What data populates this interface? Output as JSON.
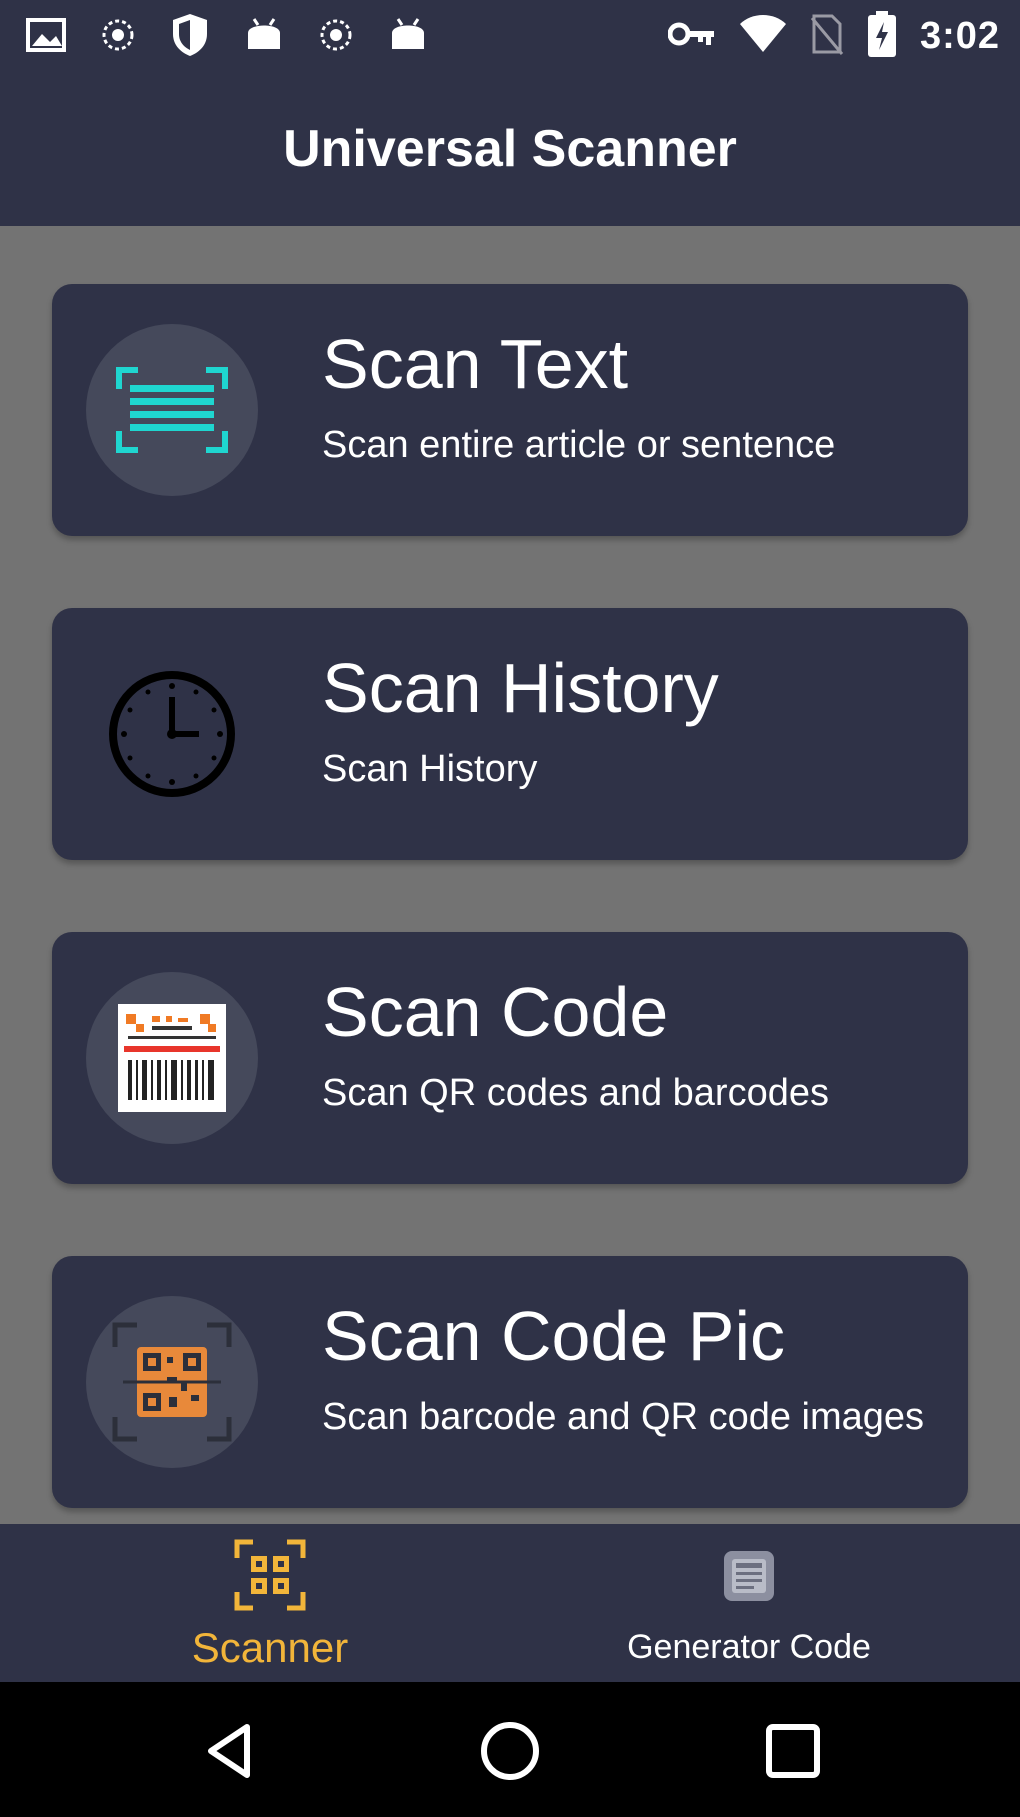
{
  "status_bar": {
    "time": "3:02",
    "left_icons": [
      "image-icon",
      "settings-dot-icon",
      "shield-icon",
      "android-icon",
      "settings-dot-icon",
      "android-icon"
    ],
    "right_icons": [
      "key-icon",
      "wifi-icon",
      "no-sim-icon",
      "battery-icon"
    ]
  },
  "app_bar": {
    "title": "Universal Scanner"
  },
  "cards": [
    {
      "title": "Scan Text",
      "subtitle": "Scan entire article or sentence",
      "icon": "text-scan-icon"
    },
    {
      "title": "Scan History",
      "subtitle": "Scan History",
      "icon": "clock-icon"
    },
    {
      "title": "Scan Code",
      "subtitle": "Scan QR codes and barcodes",
      "icon": "barcode-icon"
    },
    {
      "title": "Scan Code Pic",
      "subtitle": "Scan barcode and QR code images",
      "icon": "qr-image-icon"
    }
  ],
  "bottom_nav": {
    "items": [
      {
        "label": "Scanner",
        "icon": "scanner-icon",
        "active": true
      },
      {
        "label": "Generator Code",
        "icon": "generator-icon",
        "active": false
      }
    ]
  },
  "colors": {
    "bar_background": "#2f3247",
    "page_background": "#737373",
    "accent": "#f2b53a",
    "teal": "#1fd6d0",
    "icon_circle": "#45495b"
  },
  "system_nav": {
    "buttons": [
      "back-icon",
      "home-icon",
      "recents-icon"
    ]
  }
}
